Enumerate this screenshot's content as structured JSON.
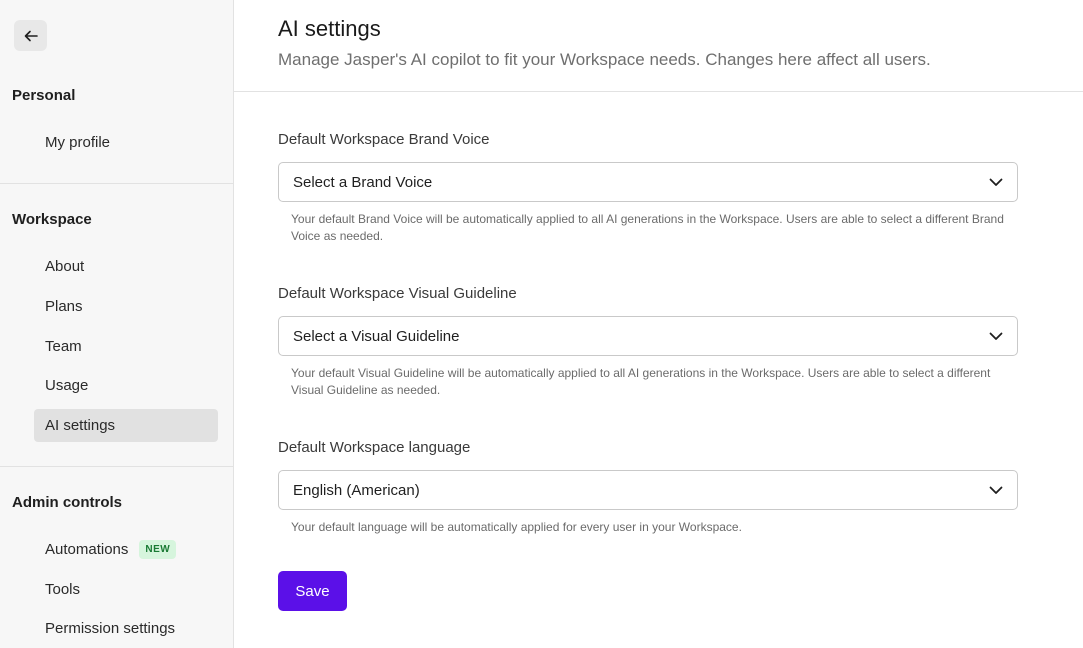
{
  "sidebar": {
    "back_icon": "arrow-left-icon",
    "personal": {
      "title": "Personal",
      "items": [
        {
          "label": "My profile"
        }
      ]
    },
    "workspace": {
      "title": "Workspace",
      "items": [
        {
          "label": "About"
        },
        {
          "label": "Plans"
        },
        {
          "label": "Team"
        },
        {
          "label": "Usage"
        },
        {
          "label": "AI settings",
          "active": true
        }
      ]
    },
    "admin": {
      "title": "Admin controls",
      "items": [
        {
          "label": "Automations",
          "badge": "NEW"
        },
        {
          "label": "Tools"
        },
        {
          "label": "Permission settings"
        }
      ]
    }
  },
  "header": {
    "title": "AI settings",
    "subtitle": "Manage Jasper's AI copilot to fit your Workspace needs. Changes here affect all users."
  },
  "fields": {
    "brand_voice": {
      "label": "Default Workspace Brand Voice",
      "value": "Select a Brand Voice",
      "help": "Your default Brand Voice will be automatically applied to all AI generations in the Workspace. Users are able to select a different Brand Voice as needed."
    },
    "visual_guideline": {
      "label": "Default Workspace Visual Guideline",
      "value": "Select a Visual Guideline",
      "help": "Your default Visual Guideline will be automatically applied to all AI generations in the Workspace. Users are able to select a different Visual Guideline as needed."
    },
    "language": {
      "label": "Default Workspace language",
      "value": "English (American)",
      "help": "Your default language will be automatically applied for every user in your Workspace."
    }
  },
  "actions": {
    "save_label": "Save"
  },
  "colors": {
    "accent": "#5b10e8",
    "badge_bg": "#d6f5dd",
    "badge_text": "#1a7a34",
    "active_nav_bg": "#e1e1e1"
  }
}
